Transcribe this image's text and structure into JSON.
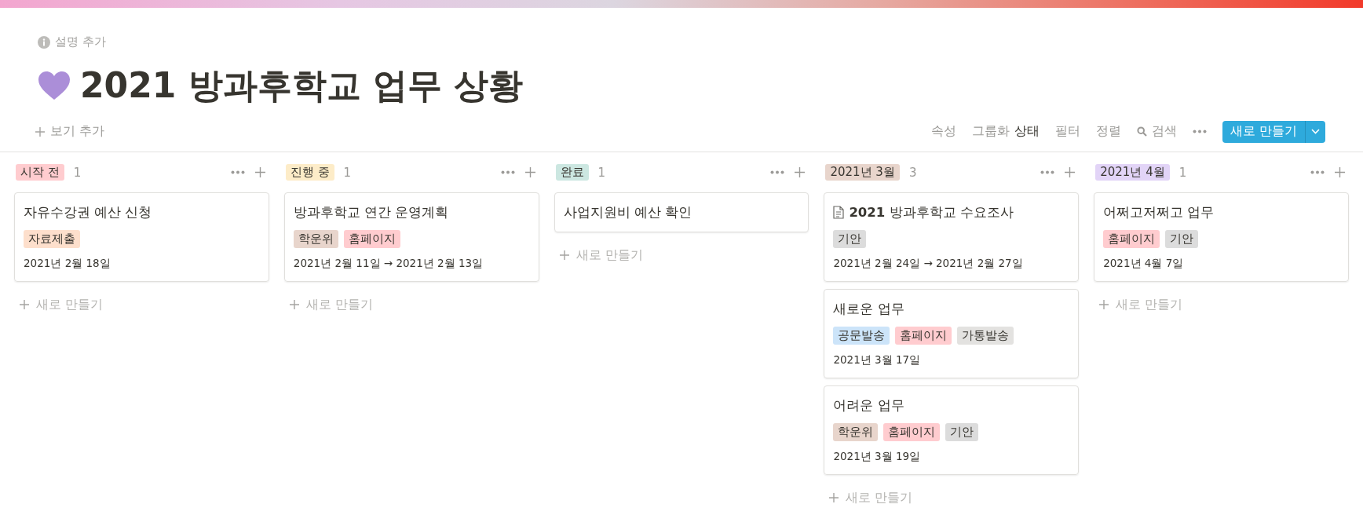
{
  "header": {
    "description_button": "설명 추가",
    "title": "2021 방과후학교 업무 상황"
  },
  "toolbar": {
    "add_view": "보기 추가",
    "properties": "속성",
    "group_by_label": "그룹화",
    "group_by_value": "상태",
    "filter": "필터",
    "sort": "정렬",
    "search": "검색",
    "new_button": "새로 만들기"
  },
  "columns": [
    {
      "label": "시작 전",
      "color": "#ffcccf",
      "count": "1",
      "cards": [
        {
          "kind": "plain",
          "title": "자유수강권 예산 신청",
          "tags": [
            {
              "label": "자료제출",
              "color": "#fddfcc"
            }
          ],
          "date": "2021년 2월 18일"
        }
      ],
      "new_item": "새로 만들기"
    },
    {
      "label": "진행 중",
      "color": "#fdecc8",
      "count": "1",
      "cards": [
        {
          "kind": "plain",
          "title": "방과후학교 연간 운영계획",
          "tags": [
            {
              "label": "학운위",
              "color": "#e8d5cc"
            },
            {
              "label": "홈페이지",
              "color": "#ffcccf"
            }
          ],
          "date": "2021년 2월 11일 → 2021년 2월 13일"
        }
      ],
      "new_item": "새로 만들기"
    },
    {
      "label": "완료",
      "color": "#cce7e1",
      "count": "1",
      "cards": [
        {
          "kind": "plain",
          "title": "사업지원비 예산 확인"
        }
      ],
      "new_item": "새로 만들기"
    },
    {
      "label": "2021년 3월",
      "color": "#e8d5cc",
      "count": "3",
      "cards": [
        {
          "kind": "page",
          "title": "**2021** 방과후학교 수요조사",
          "tags": [
            {
              "label": "기안",
              "color": "#dcdcdc"
            }
          ],
          "date": "2021년 2월 24일 → 2021년 2월 27일"
        },
        {
          "kind": "plain",
          "title": "새로운 업무",
          "tags": [
            {
              "label": "공문발송",
              "color": "#cce4f9"
            },
            {
              "label": "홈페이지",
              "color": "#ffcccf"
            },
            {
              "label": "가통발송",
              "color": "#e3e2e0"
            }
          ],
          "date": "2021년 3월 17일"
        },
        {
          "kind": "plain",
          "title": "어려운 업무",
          "tags": [
            {
              "label": "학운위",
              "color": "#e8d5cc"
            },
            {
              "label": "홈페이지",
              "color": "#ffcccf"
            },
            {
              "label": "기안",
              "color": "#dcdcdc"
            }
          ],
          "date": "2021년 3월 19일"
        }
      ],
      "new_item": "새로 만들기"
    },
    {
      "label": "2021년 4월",
      "color": "#e2d4f7",
      "count": "1",
      "cards": [
        {
          "kind": "plain",
          "title": "어쩌고저쩌고 업무",
          "tags": [
            {
              "label": "홈페이지",
              "color": "#ffcccf"
            },
            {
              "label": "기안",
              "color": "#dcdcdc"
            }
          ],
          "date": "2021년 4월 7일"
        }
      ],
      "new_item": "새로 만들기"
    }
  ]
}
